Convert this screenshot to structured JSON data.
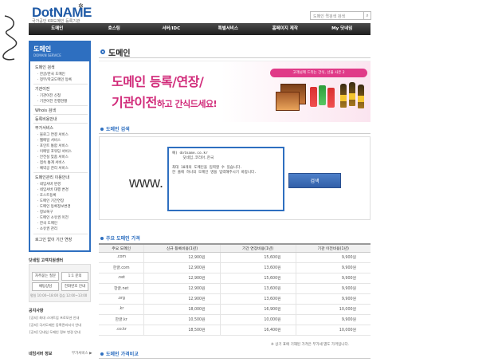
{
  "header": {
    "logo_dot": "Dot",
    "logo_name": "NAME",
    "logo_sub": "국가공인 KR도메인 등록기관",
    "search_placeholder": "도메인 퀵검색 검색",
    "nav": [
      "도메인",
      "호스팅",
      "서버/IDC",
      "특별서비스",
      "홈페이지 제작",
      "My 닷네임"
    ]
  },
  "sidebar": {
    "title": "도메인",
    "subtitle": "DOMAIN SERVICE",
    "sections": [
      {
        "label": "도메인 검색",
        "items": [
          "· 한글/한국 도메인",
          "· 정부/학교도메인 등록"
        ]
      },
      {
        "label": "기관이전",
        "items": [
          "· 기관이전 신청",
          "· 기관이전 진행현황"
        ]
      },
      {
        "label": "Whois 검색",
        "items": []
      },
      {
        "label": "등록비용안내",
        "items": []
      },
      {
        "label": "부가서비스",
        "items": [
          "· 블로그 연결 서비스",
          "· 웹메일 서비스",
          "· 포인트 통합 서비스",
          "· 이메일 포워딩 서비스",
          "· 안전실 맞춤 서비스",
          "· 접속 통계 서비스",
          "· 예약공 관리 서비스"
        ]
      },
      {
        "label": "도메인관리 이용안내",
        "items": [
          "· 네임서버 변경",
          "· 네임서버 대행 변경",
          "· 호스트등록",
          "· 도메인 기간연장",
          "· 도메인 등록정보변경",
          "· 정보복구",
          "· 도메인 소유권 이전",
          "· 한국 도메인",
          "· 소유권 관리"
        ]
      },
      {
        "label": "로그인 없이 기간 연장",
        "items": []
      }
    ]
  },
  "customer_center": {
    "title": "닷네임 고객지원센터",
    "buttons": [
      "자주묻는 질문",
      "1:1 문의",
      "채팅상담",
      "전화번호 안내"
    ],
    "hours": "평일 10:00~18:00 점심 12:00~13:00"
  },
  "notices": {
    "title": "공지사항",
    "items": [
      "[공지] 최대 스마트업 프로모션 안내",
      "[공지] 국가도메인 등록관리서식 안내",
      "[공지] 닷네임 도메인 정보 변경 안내"
    ]
  },
  "info": {
    "title": "네임서버 정보",
    "more": "부가서비스 ▶"
  },
  "main": {
    "page_title": "도메인",
    "banner": {
      "line1": "도메인 등록/연장/",
      "line2_big": "기관이전",
      "line2_small": "하고 간식드세요!",
      "tag": "고객님께 드리는 간식, 선물 사은 2"
    },
    "search_section": {
      "title": "도메인 검색",
      "prefix": "www.",
      "textarea_value": "예) dotname.co.kr\n     닷네임.코리아.한국\n\n최대 10개의 도메인을 입력할 수 있습니다.\n한 줄에 하나의 도메인 명을 입력해주시기 바랍니다.",
      "button": "검색"
    },
    "price_section": {
      "title": "주요 도메인 가격",
      "headers": [
        "주요 도메인",
        "신규 등록비용(1년)",
        "기간 연장비용(1년)",
        "기관 이전비용(1년)"
      ],
      "rows": [
        [
          ".com",
          "12,900원",
          "15,600원",
          "9,900원"
        ],
        [
          "한글.com",
          "12,900원",
          "13,600원",
          "9,900원"
        ],
        [
          ".net",
          "12,900원",
          "15,600원",
          "9,900원"
        ],
        [
          "한글.net",
          "12,900원",
          "13,600원",
          "9,900원"
        ],
        [
          ".org",
          "12,900원",
          "13,600원",
          "9,900원"
        ],
        [
          ".kr",
          "18,000원",
          "16,900원",
          "10,000원"
        ],
        [
          "한글.kr",
          "10,500원",
          "10,000원",
          "9,900원"
        ],
        [
          ".co.kr",
          "18,500원",
          "16,400원",
          "10,000원"
        ]
      ],
      "note": "※ 상기 표에 기재된 가격은 부가세 별도 가격입니다."
    },
    "compare_section": {
      "title": "도메인 가격비교"
    }
  }
}
